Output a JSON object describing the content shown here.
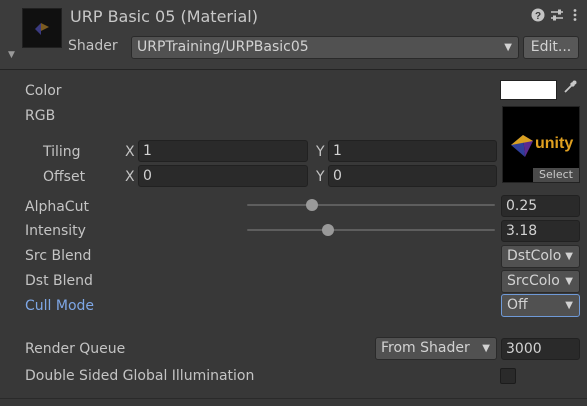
{
  "header": {
    "title": "URP Basic 05 (Material)",
    "shader_label": "Shader",
    "shader_value": "URPTraining/URPBasic05",
    "edit_label": "Edit...",
    "icons": [
      "help-icon",
      "preset-icon",
      "menu-kebab-icon"
    ]
  },
  "properties": {
    "color_label": "Color",
    "color_value": "#ffffff",
    "rgb_label": "RGB",
    "texture_text": "unity",
    "texture_select_label": "Select",
    "tiling_label": "Tiling",
    "offset_label": "Offset",
    "x_label": "X",
    "y_label": "Y",
    "tiling_x": "1",
    "tiling_y": "1",
    "offset_x": "0",
    "offset_y": "0",
    "alphacut_label": "AlphaCut",
    "alphacut_value": "0.25",
    "intensity_label": "Intensity",
    "intensity_value": "3.18",
    "src_blend_label": "Src Blend",
    "src_blend_value": "DstColo",
    "dst_blend_label": "Dst Blend",
    "dst_blend_value": "SrcColo",
    "cull_mode_label": "Cull Mode",
    "cull_mode_value": "Off",
    "render_queue_label": "Render Queue",
    "render_queue_mode": "From Shader",
    "render_queue_value": "3000",
    "dsgi_label": "Double Sided Global Illumination",
    "dsgi_checked": false
  },
  "colors": {
    "accent_blue": "#7ea7e6",
    "panel": "#383838"
  }
}
